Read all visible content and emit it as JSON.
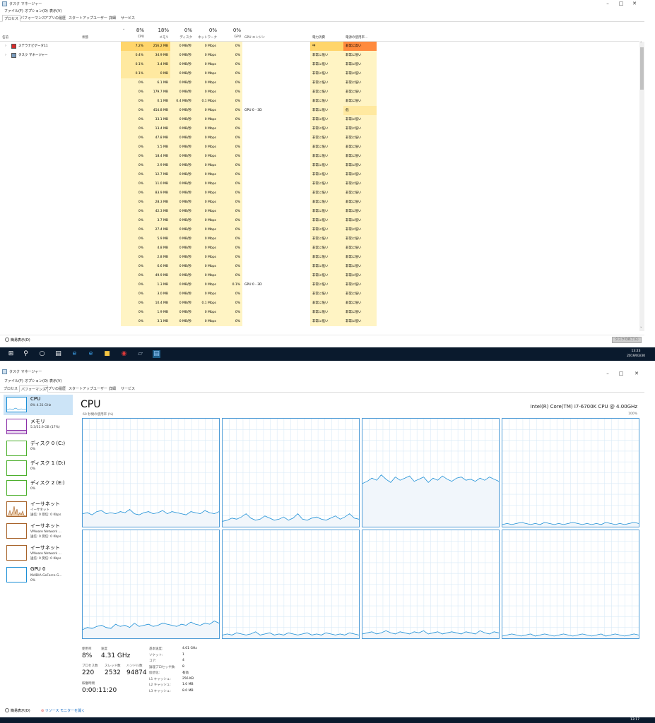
{
  "window1": {
    "title": "タスク マネージャー",
    "menus": [
      "ファイル(F)",
      "オプション(O)",
      "表示(V)"
    ],
    "tabs": [
      "プロセス",
      "パフォーマンス",
      "アプリの履歴",
      "スタートアップ",
      "ユーザー",
      "詳細",
      "サービス"
    ],
    "columns": {
      "name": "名前",
      "status": "状態",
      "cpu_pct": "8%",
      "cpu": "CPU",
      "mem_pct": "18%",
      "mem": "メモリ",
      "disk_pct": "0%",
      "disk": "ディスク",
      "net_pct": "0%",
      "net": "ネットワーク",
      "gpu_pct": "0%",
      "gpu": "GPU",
      "gpu_engine": "GPU エンジン",
      "power": "電力消費",
      "power_trend": "電源の使用率..."
    },
    "rows": [
      {
        "name": "ステラナビゲータ11",
        "cpu": "7.2%",
        "mem": "256.2 MB",
        "disk": "0 MB/秒",
        "net": "0 Mbps",
        "gpu": "0%",
        "eng": "",
        "pow": "中",
        "pt": "非常に高い",
        "band": "dark"
      },
      {
        "name": "タスク マネージャー",
        "cpu": "0.4%",
        "mem": "34.9 MB",
        "disk": "0 MB/秒",
        "net": "0 Mbps",
        "gpu": "0%",
        "eng": "",
        "pow": "非常に低い",
        "pt": "非常に低い",
        "band": "mid"
      },
      {
        "name": "",
        "cpu": "0.1%",
        "mem": "3.4 MB",
        "disk": "0 MB/秒",
        "net": "0 Mbps",
        "gpu": "0%",
        "eng": "",
        "pow": "非常に低い",
        "pt": "非常に低い",
        "band": "mid"
      },
      {
        "name": "",
        "cpu": "0.1%",
        "mem": "0 MB",
        "disk": "0 MB/秒",
        "net": "0 Mbps",
        "gpu": "0%",
        "eng": "",
        "pow": "非常に低い",
        "pt": "非常に低い",
        "band": "mid"
      },
      {
        "name": "",
        "cpu": "0%",
        "mem": "6.1 MB",
        "disk": "0 MB/秒",
        "net": "0 Mbps",
        "gpu": "0%",
        "eng": "",
        "pow": "非常に低い",
        "pt": "非常に低い",
        "band": "light"
      },
      {
        "name": "",
        "cpu": "0%",
        "mem": "179.7 MB",
        "disk": "0 MB/秒",
        "net": "0 Mbps",
        "gpu": "0%",
        "eng": "",
        "pow": "非常に低い",
        "pt": "非常に低い",
        "band": "light"
      },
      {
        "name": "",
        "cpu": "0%",
        "mem": "0.1 MB",
        "disk": "0.4 MB/秒",
        "net": "0.1 Mbps",
        "gpu": "0%",
        "eng": "",
        "pow": "非常に低い",
        "pt": "非常に低い",
        "band": "light"
      },
      {
        "name": "",
        "cpu": "0%",
        "mem": "454.8 MB",
        "disk": "0 MB/秒",
        "net": "0 Mbps",
        "gpu": "0%",
        "eng": "GPU 0 - 3D",
        "pow": "非常に低い",
        "pt": "低",
        "band": "light"
      },
      {
        "name": "",
        "cpu": "0%",
        "mem": "33.1 MB",
        "disk": "0 MB/秒",
        "net": "0 Mbps",
        "gpu": "0%",
        "eng": "",
        "pow": "非常に低い",
        "pt": "非常に低い",
        "band": "light"
      },
      {
        "name": "",
        "cpu": "0%",
        "mem": "13.4 MB",
        "disk": "0 MB/秒",
        "net": "0 Mbps",
        "gpu": "0%",
        "eng": "",
        "pow": "非常に低い",
        "pt": "非常に低い",
        "band": "light"
      },
      {
        "name": "",
        "cpu": "0%",
        "mem": "47.8 MB",
        "disk": "0 MB/秒",
        "net": "0 Mbps",
        "gpu": "0%",
        "eng": "",
        "pow": "非常に低い",
        "pt": "非常に低い",
        "band": "light"
      },
      {
        "name": "",
        "cpu": "0%",
        "mem": "5.5 MB",
        "disk": "0 MB/秒",
        "net": "0 Mbps",
        "gpu": "0%",
        "eng": "",
        "pow": "非常に低い",
        "pt": "非常に低い",
        "band": "light"
      },
      {
        "name": "",
        "cpu": "0%",
        "mem": "18.4 MB",
        "disk": "0 MB/秒",
        "net": "0 Mbps",
        "gpu": "0%",
        "eng": "",
        "pow": "非常に低い",
        "pt": "非常に低い",
        "band": "light"
      },
      {
        "name": "",
        "cpu": "0%",
        "mem": "2.9 MB",
        "disk": "0 MB/秒",
        "net": "0 Mbps",
        "gpu": "0%",
        "eng": "",
        "pow": "非常に低い",
        "pt": "非常に低い",
        "band": "light"
      },
      {
        "name": "",
        "cpu": "0%",
        "mem": "12.7 MB",
        "disk": "0 MB/秒",
        "net": "0 Mbps",
        "gpu": "0%",
        "eng": "",
        "pow": "非常に低い",
        "pt": "非常に低い",
        "band": "light"
      },
      {
        "name": "",
        "cpu": "0%",
        "mem": "11.0 MB",
        "disk": "0 MB/秒",
        "net": "0 Mbps",
        "gpu": "0%",
        "eng": "",
        "pow": "非常に低い",
        "pt": "非常に低い",
        "band": "light"
      },
      {
        "name": "",
        "cpu": "0%",
        "mem": "83.9 MB",
        "disk": "0 MB/秒",
        "net": "0 Mbps",
        "gpu": "0%",
        "eng": "",
        "pow": "非常に低い",
        "pt": "非常に低い",
        "band": "light"
      },
      {
        "name": "",
        "cpu": "0%",
        "mem": "28.3 MB",
        "disk": "0 MB/秒",
        "net": "0 Mbps",
        "gpu": "0%",
        "eng": "",
        "pow": "非常に低い",
        "pt": "非常に低い",
        "band": "light"
      },
      {
        "name": "",
        "cpu": "0%",
        "mem": "42.3 MB",
        "disk": "0 MB/秒",
        "net": "0 Mbps",
        "gpu": "0%",
        "eng": "",
        "pow": "非常に低い",
        "pt": "非常に低い",
        "band": "light"
      },
      {
        "name": "",
        "cpu": "0%",
        "mem": "3.7 MB",
        "disk": "0 MB/秒",
        "net": "0 Mbps",
        "gpu": "0%",
        "eng": "",
        "pow": "非常に低い",
        "pt": "非常に低い",
        "band": "light"
      },
      {
        "name": "",
        "cpu": "0%",
        "mem": "27.4 MB",
        "disk": "0 MB/秒",
        "net": "0 Mbps",
        "gpu": "0%",
        "eng": "",
        "pow": "非常に低い",
        "pt": "非常に低い",
        "band": "light"
      },
      {
        "name": "",
        "cpu": "0%",
        "mem": "5.9 MB",
        "disk": "0 MB/秒",
        "net": "0 Mbps",
        "gpu": "0%",
        "eng": "",
        "pow": "非常に低い",
        "pt": "非常に低い",
        "band": "light"
      },
      {
        "name": "",
        "cpu": "0%",
        "mem": "4.8 MB",
        "disk": "0 MB/秒",
        "net": "0 Mbps",
        "gpu": "0%",
        "eng": "",
        "pow": "非常に低い",
        "pt": "非常に低い",
        "band": "light"
      },
      {
        "name": "",
        "cpu": "0%",
        "mem": "2.8 MB",
        "disk": "0 MB/秒",
        "net": "0 Mbps",
        "gpu": "0%",
        "eng": "",
        "pow": "非常に低い",
        "pt": "非常に低い",
        "band": "light"
      },
      {
        "name": "",
        "cpu": "0%",
        "mem": "6.6 MB",
        "disk": "0 MB/秒",
        "net": "0 Mbps",
        "gpu": "0%",
        "eng": "",
        "pow": "非常に低い",
        "pt": "非常に低い",
        "band": "light"
      },
      {
        "name": "",
        "cpu": "0%",
        "mem": "49.9 MB",
        "disk": "0 MB/秒",
        "net": "0 Mbps",
        "gpu": "0%",
        "eng": "",
        "pow": "非常に低い",
        "pt": "非常に低い",
        "band": "light"
      },
      {
        "name": "",
        "cpu": "0%",
        "mem": "1.3 MB",
        "disk": "0 MB/秒",
        "net": "0 Mbps",
        "gpu": "0.1%",
        "eng": "GPU 0 - 3D",
        "pow": "非常に低い",
        "pt": "非常に低い",
        "band": "light"
      },
      {
        "name": "",
        "cpu": "0%",
        "mem": "3.0 MB",
        "disk": "0 MB/秒",
        "net": "0 Mbps",
        "gpu": "0%",
        "eng": "",
        "pow": "非常に低い",
        "pt": "非常に低い",
        "band": "light"
      },
      {
        "name": "",
        "cpu": "0%",
        "mem": "10.4 MB",
        "disk": "0 MB/秒",
        "net": "0.1 Mbps",
        "gpu": "0%",
        "eng": "",
        "pow": "非常に低い",
        "pt": "非常に低い",
        "band": "light"
      },
      {
        "name": "",
        "cpu": "0%",
        "mem": "1.9 MB",
        "disk": "0 MB/秒",
        "net": "0 Mbps",
        "gpu": "0%",
        "eng": "",
        "pow": "非常に低い",
        "pt": "非常に低い",
        "band": "light"
      },
      {
        "name": "",
        "cpu": "0%",
        "mem": "3.1 MB",
        "disk": "0 MB/秒",
        "net": "0 Mbps",
        "gpu": "0%",
        "eng": "",
        "pow": "非常に低い",
        "pt": "非常に低い",
        "band": "light"
      }
    ],
    "footer_less": "簡易表示(D)",
    "end_task": "タスクの終了(E)",
    "clock_time": "13:23",
    "clock_date": "2019/03/30"
  },
  "window2": {
    "title": "タスク マネージャー",
    "menus": [
      "ファイル(F)",
      "オプション(O)",
      "表示(V)"
    ],
    "tabs": [
      "プロセス",
      "パフォーマンス",
      "アプリの履歴",
      "スタートアップ",
      "ユーザー",
      "詳細",
      "サービス"
    ],
    "sidebar": [
      {
        "title": "CPU",
        "sub": "8%  4.31 GHz",
        "color": "#1c8fd6"
      },
      {
        "title": "メモリ",
        "sub": "5.3/31.9 GB (17%)",
        "color": "#8b2fa8"
      },
      {
        "title": "ディスク 0 (C:)",
        "sub": "0%",
        "color": "#4caf2c"
      },
      {
        "title": "ディスク 1 (D:)",
        "sub": "0%",
        "color": "#4caf2c"
      },
      {
        "title": "ディスク 2 (E:)",
        "sub": "0%",
        "color": "#4caf2c"
      },
      {
        "title": "イーサネット",
        "sub": "イーサネット\n送信: 0 受信: 0 Kbps",
        "color": "#a7632a"
      },
      {
        "title": "イーサネット",
        "sub": "VMware Network ...\n送信: 0 受信: 0 Kbps",
        "color": "#a7632a"
      },
      {
        "title": "イーサネット",
        "sub": "VMware Network ...\n送信: 0 受信: 0 Kbps",
        "color": "#a7632a"
      },
      {
        "title": "GPU 0",
        "sub": "NVIDIA GeForce G...\n0%",
        "color": "#1c8fd6"
      }
    ],
    "main_title": "CPU",
    "cpu_model": "Intel(R) Core(TM) i7-6700K CPU @ 4.00GHz",
    "graph_caption": "60 秒間の使用率 (%)",
    "graph_max": "100%",
    "stats": {
      "util_label": "使用率",
      "util": "8%",
      "speed_label": "速度",
      "speed": "4.31 GHz",
      "proc_label": "プロセス数",
      "proc": "220",
      "thread_label": "スレッド数",
      "thread": "2532",
      "handle_label": "ハンドル数",
      "handle": "94874",
      "uptime_label": "稼働時間",
      "uptime": "0:00:11:20"
    },
    "specs": [
      {
        "k": "基本速度:",
        "v": "4.01 GHz"
      },
      {
        "k": "ソケット:",
        "v": "1"
      },
      {
        "k": "コア:",
        "v": "4"
      },
      {
        "k": "論理プロセッサ数:",
        "v": "8"
      },
      {
        "k": "仮想化:",
        "v": "有効"
      },
      {
        "k": "L1 キャッシュ:",
        "v": "256 KB"
      },
      {
        "k": "L2 キャッシュ:",
        "v": "1.0 MB"
      },
      {
        "k": "L3 キャッシュ:",
        "v": "8.0 MB"
      }
    ],
    "footer_less": "簡易表示(D)",
    "footer_link": "リソース モニターを開く",
    "clock_time": "13:17"
  },
  "core_usage": [
    [
      12,
      13,
      11,
      14,
      15,
      12,
      13,
      12,
      14,
      13,
      16,
      12,
      11,
      13,
      14,
      12,
      13,
      15,
      12,
      14,
      13,
      12,
      11,
      14,
      13,
      12,
      15,
      13,
      12,
      14
    ],
    [
      5,
      6,
      8,
      7,
      9,
      12,
      8,
      6,
      7,
      10,
      8,
      6,
      7,
      9,
      6,
      8,
      12,
      7,
      6,
      8,
      9,
      7,
      6,
      8,
      10,
      7,
      9,
      12,
      8,
      7
    ],
    [
      40,
      42,
      45,
      43,
      48,
      44,
      41,
      46,
      43,
      45,
      47,
      42,
      44,
      46,
      41,
      45,
      43,
      47,
      44,
      42,
      45,
      46,
      43,
      44,
      42,
      45,
      43,
      46,
      44,
      42
    ],
    [
      2,
      3,
      2,
      3,
      4,
      3,
      2,
      3,
      2,
      4,
      3,
      2,
      3,
      2,
      3,
      4,
      3,
      2,
      3,
      2,
      3,
      2,
      4,
      3,
      2,
      3,
      2,
      3,
      4,
      3
    ],
    [
      8,
      10,
      9,
      11,
      12,
      10,
      9,
      13,
      11,
      12,
      10,
      14,
      11,
      12,
      13,
      11,
      12,
      14,
      13,
      12,
      11,
      13,
      12,
      15,
      13,
      12,
      14,
      13,
      16,
      14
    ],
    [
      3,
      4,
      3,
      5,
      4,
      3,
      4,
      6,
      3,
      4,
      5,
      3,
      4,
      3,
      5,
      4,
      3,
      4,
      5,
      3,
      4,
      3,
      5,
      4,
      3,
      4,
      3,
      5,
      4,
      3
    ],
    [
      4,
      5,
      6,
      4,
      5,
      7,
      5,
      4,
      6,
      5,
      4,
      6,
      5,
      7,
      4,
      5,
      6,
      4,
      5,
      6,
      5,
      4,
      6,
      5,
      4,
      7,
      5,
      4,
      6,
      5
    ],
    [
      2,
      3,
      4,
      3,
      2,
      3,
      4,
      2,
      3,
      4,
      3,
      2,
      3,
      4,
      3,
      2,
      3,
      4,
      3,
      2,
      3,
      4,
      2,
      3,
      4,
      3,
      2,
      3,
      4,
      3
    ]
  ]
}
